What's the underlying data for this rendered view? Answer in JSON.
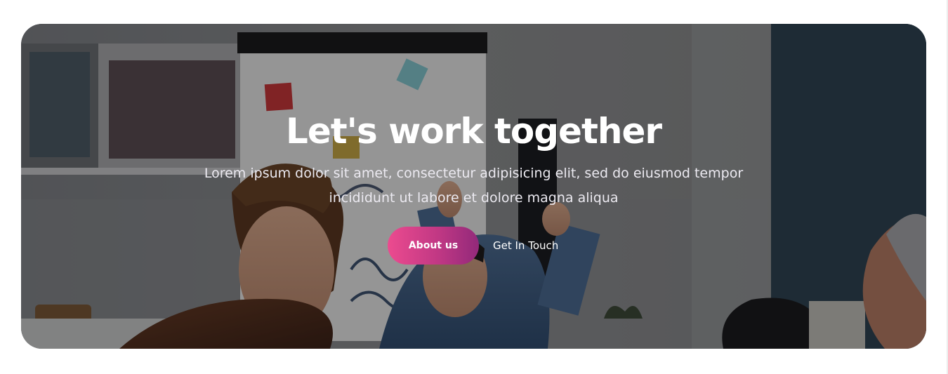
{
  "hero": {
    "title": "Let's work together",
    "subtitle": "Lorem ipsum dolor sit amet, consectetur adipisicing elit, sed do eiusmod tempor incididunt ut labore et dolore magna aliqua",
    "primary_button_label": "About us",
    "secondary_button_label": "Get In Touch"
  },
  "colors": {
    "button_gradient_start": "#ec4b8f",
    "button_gradient_end": "#92297a",
    "text": "#ffffff",
    "page_background": "#ffffff"
  }
}
